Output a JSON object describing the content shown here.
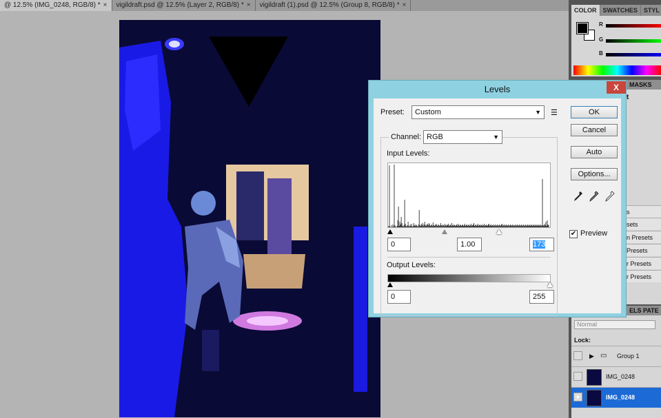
{
  "tabs": [
    {
      "label": "@ 12.5% (IMG_0248, RGB/8) *",
      "close": "×"
    },
    {
      "label": "vigildraft.psd @ 12.5% (Layer 2, RGB/8) *",
      "close": "×"
    },
    {
      "label": "vigildraft (1).psd @ 12.5% (Group 8, RGB/8) *",
      "close": "×"
    }
  ],
  "panels": {
    "color_tabs": [
      "COLOR",
      "SWATCHES",
      "STYL"
    ],
    "channels": [
      "R",
      "G",
      "B"
    ],
    "adjust_tab": "MASKS",
    "adjust_fragment": "t",
    "presets": [
      "s",
      "sets",
      "n Presets",
      "Presets",
      "r Presets",
      "r Presets"
    ],
    "layers_tabs": "ELS PATE",
    "blend_mode": "Normal",
    "lock_label": "Lock:",
    "layers": [
      {
        "name": "Group 1",
        "visible": false
      },
      {
        "name": "IMG_0248",
        "visible": false
      },
      {
        "name": "IMG_0248",
        "visible": true,
        "selected": true
      }
    ]
  },
  "levels": {
    "title": "Levels",
    "close_glyph": "X",
    "preset_label": "Preset:",
    "preset_value": "Custom",
    "channel_label": "Channel:",
    "channel_value": "RGB",
    "input_label": "Input Levels:",
    "output_label": "Output Levels:",
    "input_black": "0",
    "input_gamma": "1.00",
    "input_white": "173",
    "output_black": "0",
    "output_white": "255",
    "buttons": {
      "ok": "OK",
      "cancel": "Cancel",
      "auto": "Auto",
      "options": "Options..."
    },
    "preview_label": "Preview",
    "preview_checked": true,
    "histogram": [
      2,
      90,
      1,
      0,
      3,
      0,
      4,
      1,
      95,
      3,
      1,
      0,
      2,
      10,
      30,
      2,
      8,
      4,
      15,
      6,
      2,
      1,
      3,
      40,
      5,
      2,
      1,
      3,
      8,
      2,
      1,
      4,
      2,
      5,
      1,
      2,
      6,
      3,
      2,
      4,
      3,
      2,
      1,
      4,
      25,
      3,
      2,
      5,
      3,
      6,
      2,
      4,
      8,
      3,
      2,
      4,
      5,
      3,
      6,
      4,
      2,
      3,
      4,
      2,
      7,
      3,
      2,
      4,
      3,
      5,
      2,
      3,
      4,
      2,
      3,
      6,
      3,
      2,
      4,
      3,
      2,
      5,
      3,
      2,
      4,
      3,
      5,
      2,
      3,
      4,
      2,
      6,
      3,
      2,
      4,
      3,
      2,
      3,
      4,
      2,
      5,
      3,
      2,
      4,
      3,
      2,
      3,
      4,
      2,
      3,
      5,
      2,
      3,
      4,
      2,
      3,
      4,
      2,
      3,
      5,
      2,
      3,
      4,
      6,
      2,
      3,
      4,
      2,
      3,
      5,
      2,
      3,
      4,
      2,
      3,
      4,
      2,
      3,
      5,
      2,
      3,
      4,
      2,
      3,
      4,
      5,
      2,
      3,
      4,
      2,
      3,
      4,
      2,
      3,
      4,
      2,
      3,
      4,
      2,
      3,
      4,
      2,
      3,
      4,
      5,
      2,
      3,
      4,
      2,
      3,
      4,
      2,
      3,
      4,
      2,
      3,
      4,
      3,
      2,
      4,
      3,
      2,
      3,
      4,
      2,
      3,
      4,
      2,
      3,
      4,
      2,
      3,
      4,
      2,
      3,
      4,
      2,
      3,
      4,
      2,
      3,
      4,
      2,
      3,
      4,
      2,
      3,
      4,
      2,
      3,
      4,
      2,
      3,
      4,
      2,
      3,
      4,
      2,
      3,
      4,
      2,
      3,
      70,
      3,
      2,
      5,
      3,
      8,
      2,
      10,
      4,
      3
    ]
  },
  "colors": {
    "accent": "#1c6ad6",
    "dialog_frame": "#8ed2e2",
    "close_red": "#c8463c",
    "doc_bg": "#0a0a36"
  }
}
